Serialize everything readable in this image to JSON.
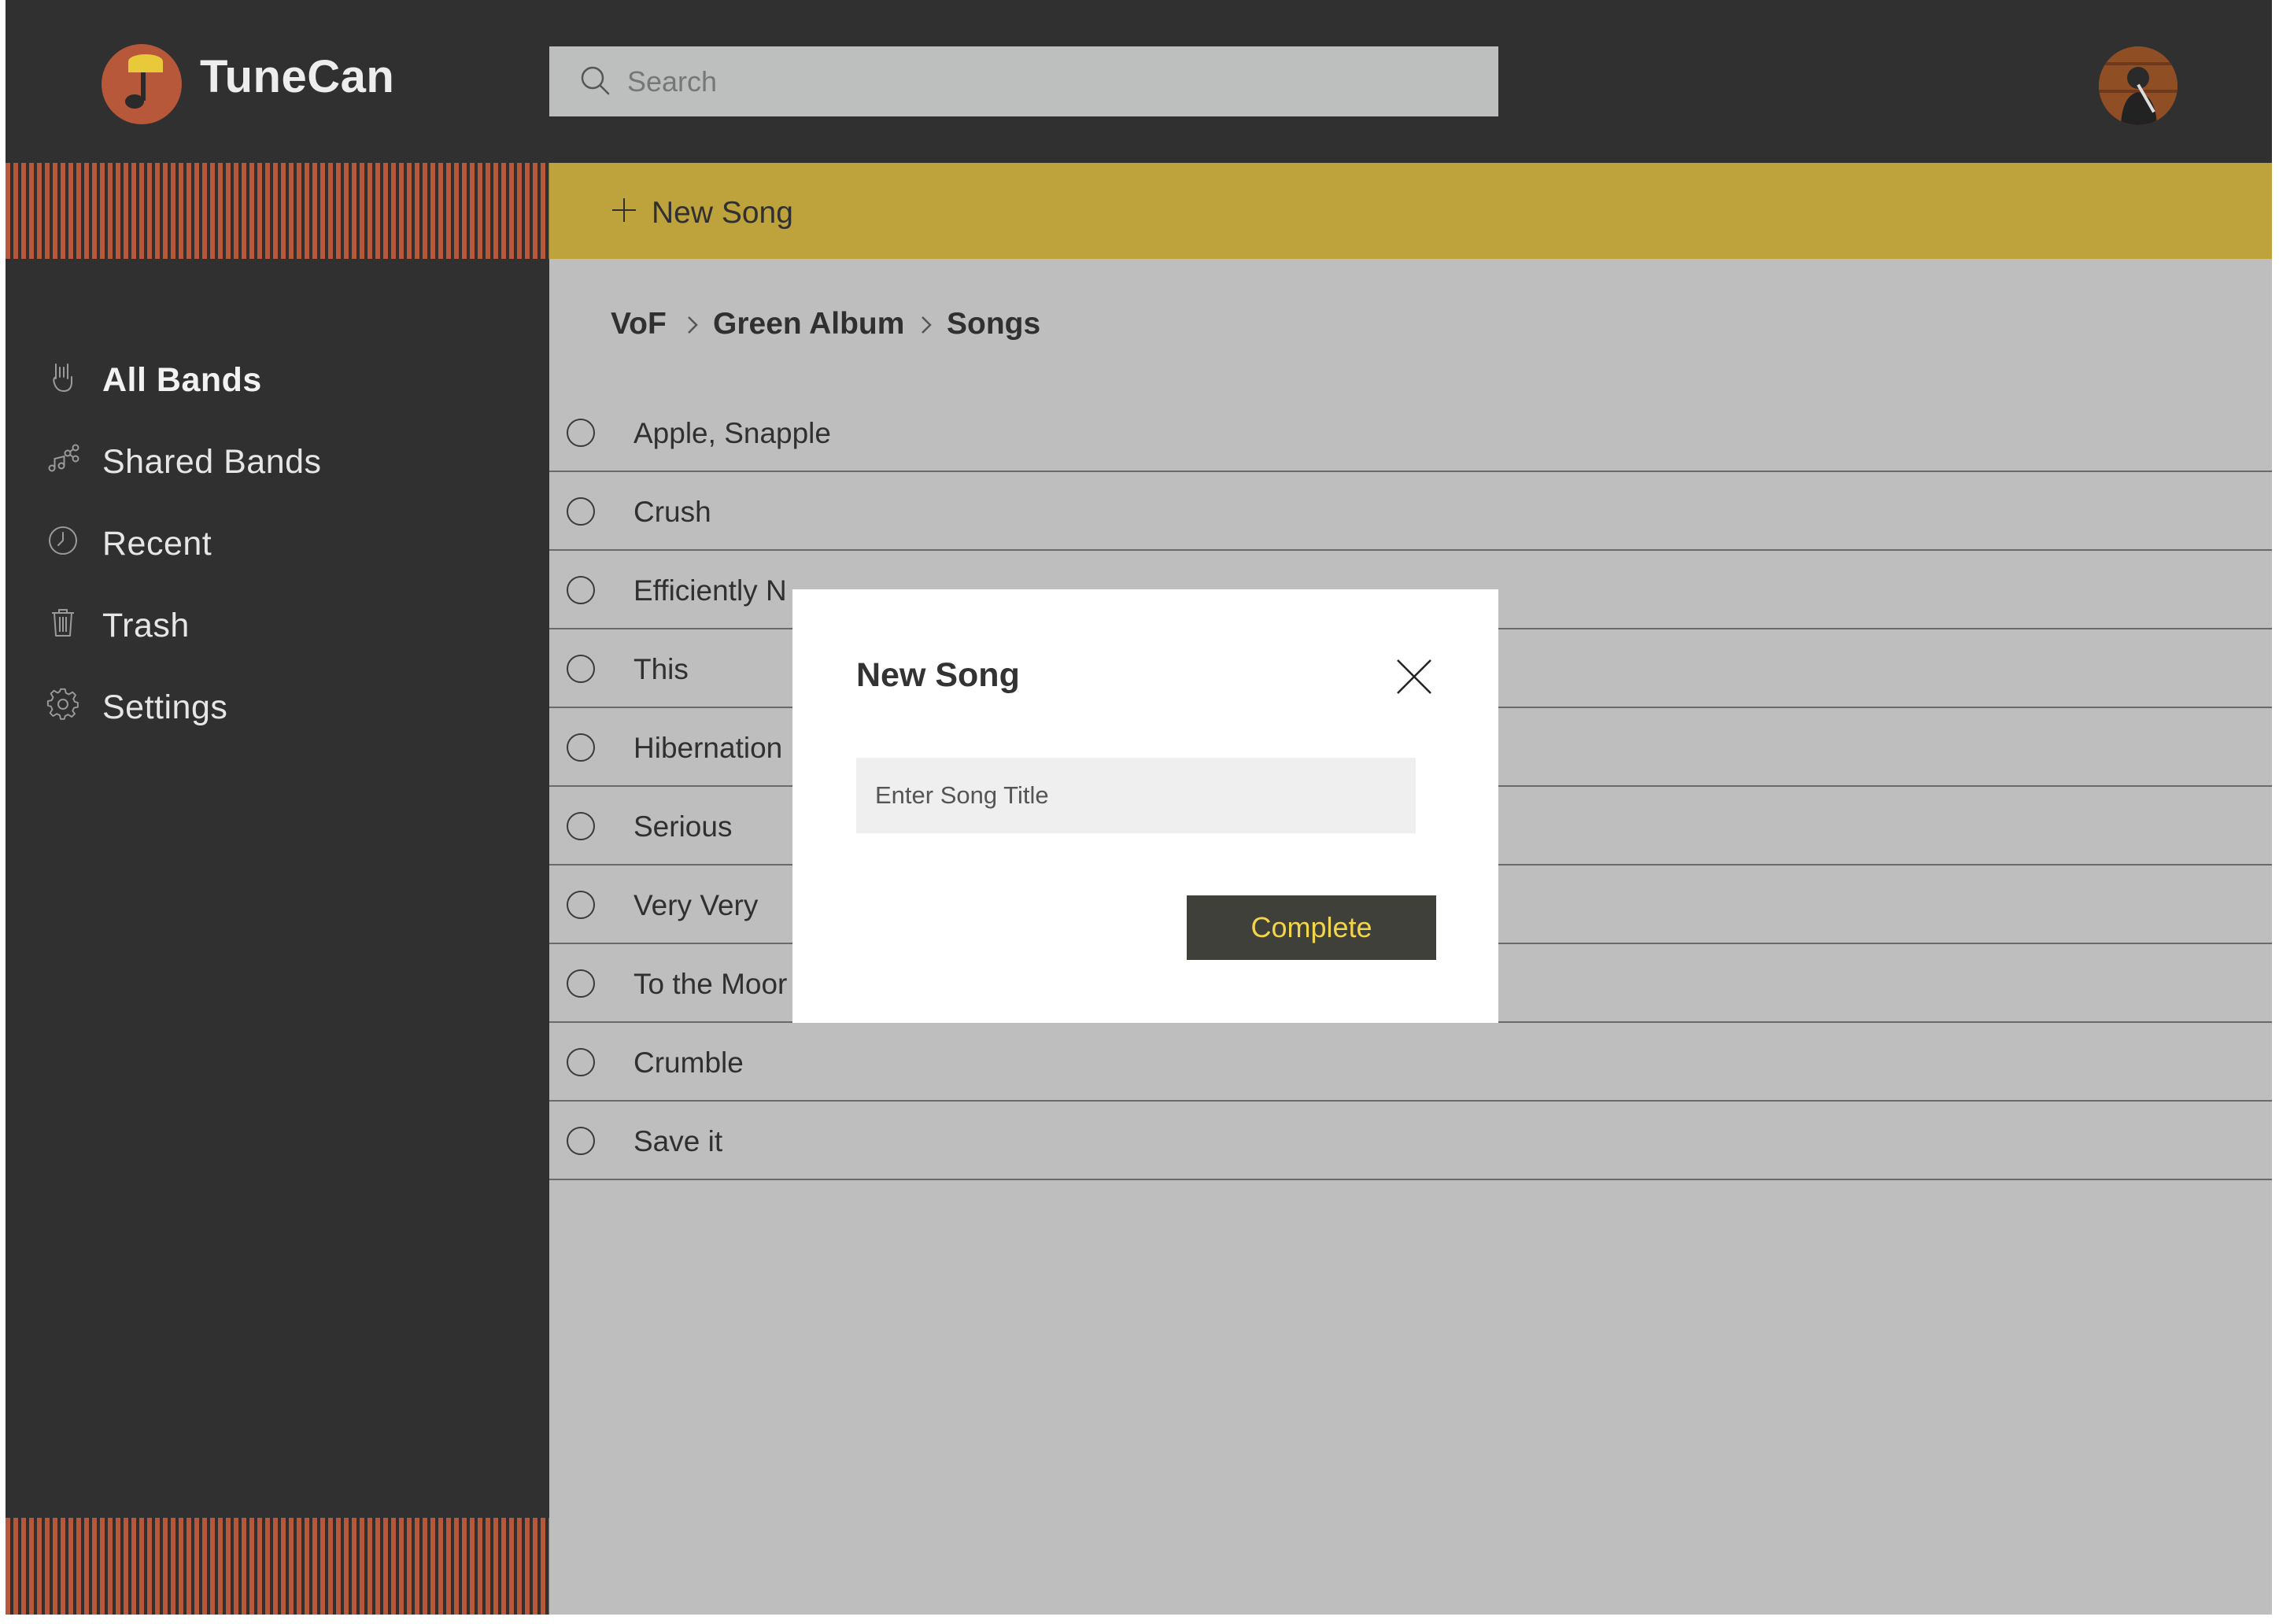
{
  "app": {
    "brand": "TuneCan"
  },
  "colors": {
    "topbar": "#303030",
    "sidebar": "#303030",
    "accent_stripe": "#b8583a",
    "gold_bar": "#bea23c",
    "content_bg": "#bebebe",
    "complete_button_bg": "#40403a",
    "complete_button_text": "#f2d54a"
  },
  "header": {
    "search_placeholder": "Search",
    "search_icon": "search-icon",
    "avatar_icon": "user-avatar"
  },
  "sidebar": {
    "items": [
      {
        "label": "All Bands",
        "icon": "rock-hand-icon",
        "active": true
      },
      {
        "label": "Shared Bands",
        "icon": "shared-music-icon",
        "active": false
      },
      {
        "label": "Recent",
        "icon": "clock-icon",
        "active": false
      },
      {
        "label": "Trash",
        "icon": "trash-icon",
        "active": false
      },
      {
        "label": "Settings",
        "icon": "gear-icon",
        "active": false
      }
    ]
  },
  "toolbar": {
    "new_song_label": "New Song",
    "new_song_icon": "plus-icon"
  },
  "breadcrumb": {
    "items": [
      "VoF",
      "Green Album",
      "Songs"
    ]
  },
  "songs": [
    "Apple, Snapple",
    "Crush",
    "Efficiently N",
    "This",
    "Hibernation",
    "Serious",
    "Very Very",
    "To the Moor",
    "Crumble",
    "Save it"
  ],
  "modal": {
    "title": "New Song",
    "input_placeholder": "Enter Song Title",
    "input_value": "",
    "submit_label": "Complete",
    "close_icon": "close-icon"
  }
}
